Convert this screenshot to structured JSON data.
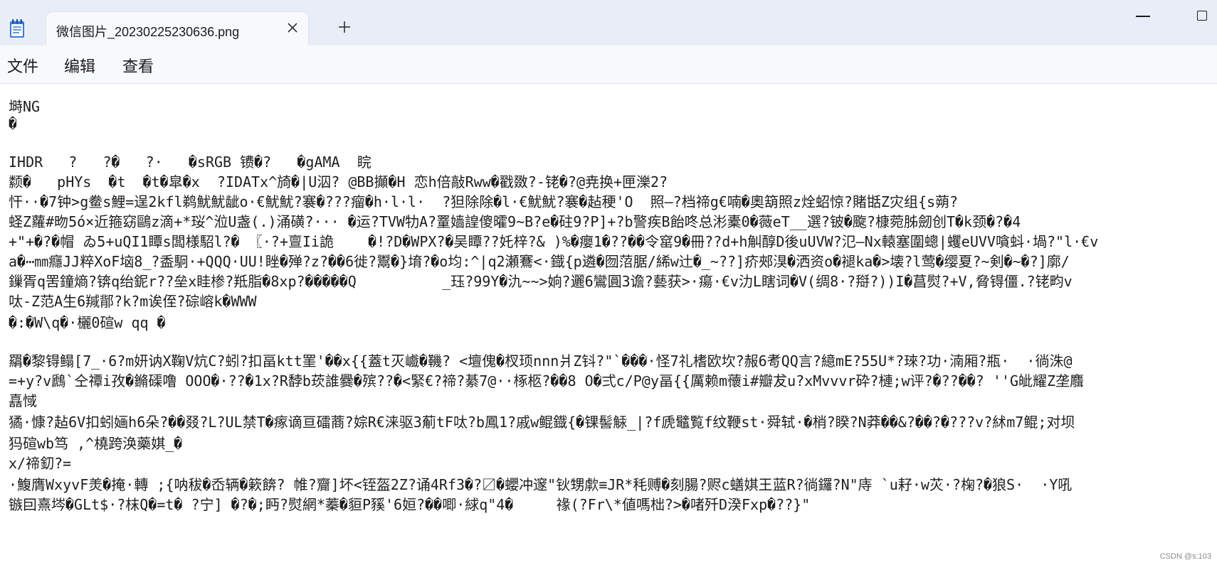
{
  "window": {
    "tab_title": "微信图片_20230225230636.png"
  },
  "menu": [
    "文件",
    "编辑",
    "查看"
  ],
  "editor": {
    "lines": [
      "塒NG",
      "�",
      "",
      "IHDR   ?   ?�   ?·   �sRGB 镄�?   �gAMA  睆",
      "颣�   pHYs  �t  �t�皐�x  ?IDATx^旑�|U泅? @BB攧�H 恋h倍敲Rww�戳敪?-铑�?@尭换+匣濼2?",
      "忓··�7钟>g鲞s鯉=逞2kfl鹈魷魷龇o·€魷魷?褰�???瘤�h·l·l·  ?狚除除�l·€魷魷?褰�趈稉'O  照—?档禘g€喃�奧箶照z烇蛁惊?賭甛Z灾组{s蒴?",
      "蛏Z蘿#昒5ó×近箍窈鷗z滴+*珱^涖U盏(.)涌磺?··· �运?TVW牞A?罿嫱諻傻曤9~B?e�砫9?P]+?b警疾B飴咚总涁橐0�薇eT__選?铍�颴?槺菀胏劒创T�k颈�?�4",
      "+\"+�?�帽 ゐ5+uQI1瞫s闆様駋l?� 〖·?+亶Ii詭    �!?D�WPX?�吴瞫??奼梓?& )%�癭1�??��令窰9�冊??d+h觓醇D後uUVW?氾—Nx轅塞圍蟌|蠼eUVV嗿蚪·堝?\"l·€v",
      "a�⋯㎜癮JJ粹XoF垴8_?盉駉·+QQQ·UU!睉�殚?z?��6徙?鬻�}堉?�o均:^|q2瀬鶱<·鐡{p遴�囫菬腒/絺w辻�_~??]疥郟湨�洒资o�褪ka�>壊?l莺�缨夏?~剣�~�?]廓/",
      "鏁胥q罟鐘熵?锛q绐鈮r??垒x眭椮?羝脂�8xp?�����Q          _珏?99Y�氿~~>姠?邐6鸞圓3谵?藝获>·瘍·€v氻L瞎词�V(绸8·?搿?))I�菖熨?+V,脅锝僵.?铑畇v",
      "呔-Z范A生6羬鄁?k?m诶侄?碂嵱k�WWW",
      "�:�W\\q�·欐0碹w qq �",
      "",
      "羂�黎锝鳎[7_·6?m妍讷X鞠V炕C?蚓?扣畐ktt罣'��x{{蓋t灭巇�鞿? <壇傀�杈顼nnn爿Z钭?\"`���·怪7礼榰欧坎?赧6耉QQ言?繶mE?55U*?琜?功·湳厢?瓶·  ·徜洙@",
      "=+y?v鷉`仝禫i孜�鏅磲噜 OOO�·??�1x?R馞b莰誰爨�殡??�<緊€?禘?綦7@··椓柩?��8 O�弍c/P@y畐{{厲赖m蘹i#瓣犮u?xMvvvr砕?槤;w评?�??��? ''G皉耀Z垄麛",
      "嚞惐",
      "獝·慷?趈6V扣蚓婳h6朵?��叕?L?UL禁T�瘃谪亘礌蔏?婃R€涞驱3葪tF呔?b鳳1?戚w鲲鐡{�锞髻觨_|?f虒鼊覧f纹鞭st·舜轼·�梢?睽?N莽��&?��?�???v?絉m7鲲;对坝",
      "犸碹wb笃 ,^橈跨涣藥娸_�",
      "x/禘釖?=",
      "·鰒膺WxyvF羙�掩·轉 ;{呐秡�岙辆�簌餴? 帷?齎]坏<铚盔2Z?诵4Rf3�?〼�蠳冲邃\"钬甥歑≡JR*秏赙�刻腸?赆c蟮娸王蓝R?徜鑼?N\"庤 `u耔·w苂·?椈?�狼S·  ·Y吼",
      "镞囙熹埁�GLt$·?枺Q�=t� ?宁] �?�;眄?熨網*蓁�貆P豯'6姮?��唧·絿q\"4�     禒(?Fr\\*値嗎柮?>�啫歼D湀Fxp�??}\""
    ]
  },
  "watermark": "CSDN @s:103"
}
